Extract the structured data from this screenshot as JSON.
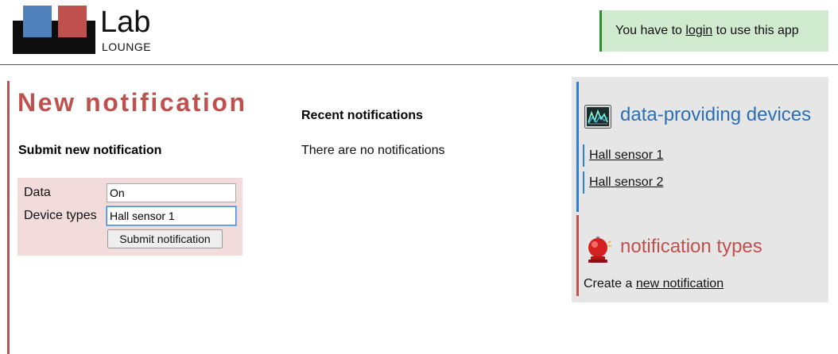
{
  "header": {
    "logo_title": "Lab",
    "logo_subtitle": "LOUNGE",
    "login_message": {
      "before": "You have to ",
      "link": "login",
      "after": " to use this app"
    }
  },
  "main": {
    "page_title": "New notification",
    "submit_section_title": "Submit new notification",
    "form": {
      "data_label": "Data",
      "data_value": "On",
      "device_types_label": "Device types",
      "device_types_value": "Hall sensor 1",
      "submit_label": "Submit notification"
    },
    "recent_title": "Recent notifications",
    "recent_empty": "There are no notifications"
  },
  "sidebar": {
    "devices": {
      "title": "data-providing devices",
      "icon": "chart-monitor-icon",
      "items": [
        {
          "label": "Hall sensor 1"
        },
        {
          "label": "Hall sensor 2"
        }
      ]
    },
    "notification_types": {
      "title": "notification types",
      "icon": "alarm-bell-icon",
      "create_prefix": "Create a ",
      "create_link": "new notification"
    }
  },
  "colors": {
    "accent_red": "#c0504d",
    "accent_blue": "#2f7fd0",
    "logo_blue": "#4f81bd",
    "login_bg": "#d0ead0",
    "form_bg": "#f2dcdb",
    "sidebar_bg": "#e6e6e6"
  }
}
